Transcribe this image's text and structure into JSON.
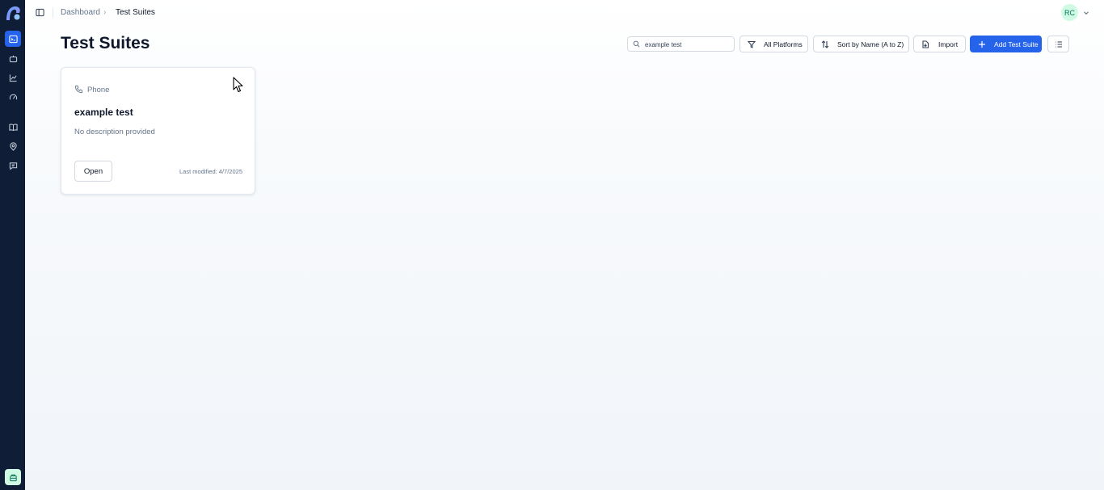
{
  "app": {
    "brand_color": "#2563eb",
    "sidebar_color": "#0f1e36"
  },
  "sidebar": {
    "items": [
      {
        "icon": "test-suites-icon",
        "active": true
      },
      {
        "icon": "bot-icon",
        "active": false
      },
      {
        "icon": "chart-line-icon",
        "active": false
      },
      {
        "icon": "gauge-icon",
        "active": false
      },
      {
        "icon": "book-icon",
        "active": false
      },
      {
        "icon": "map-pin-icon",
        "active": false
      },
      {
        "icon": "message-icon",
        "active": false
      }
    ],
    "bottom_icon": "package-icon"
  },
  "header": {
    "breadcrumb": [
      "Dashboard",
      "Test Suites"
    ],
    "avatar_initials": "RC"
  },
  "page": {
    "title": "Test Suites"
  },
  "toolbar": {
    "search_value": "example test",
    "platform_filter": "All Platforms",
    "sort_label": "Sort by Name (A to Z)",
    "import_label": "Import",
    "add_label": "Add Test Suite"
  },
  "suites": [
    {
      "platform": "Phone",
      "name": "example test",
      "description": "No description provided",
      "open_label": "Open",
      "last_modified": "Last modified: 4/7/2025"
    }
  ]
}
